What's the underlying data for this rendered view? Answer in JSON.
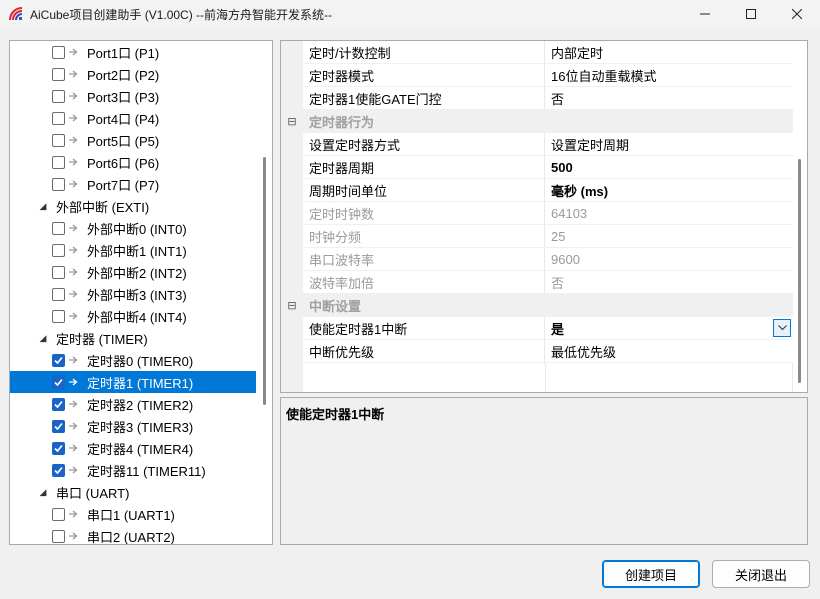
{
  "window": {
    "title": "AiCube项目创建助手 (V1.00C) --前海方舟智能开发系统--",
    "minimize_icon": "minimize-icon",
    "maximize_icon": "maximize-icon",
    "close_icon": "close-icon"
  },
  "tree": {
    "items": [
      {
        "type": "leaf",
        "label": "Port1口 (P1)",
        "checked": false
      },
      {
        "type": "leaf",
        "label": "Port2口 (P2)",
        "checked": false
      },
      {
        "type": "leaf",
        "label": "Port3口 (P3)",
        "checked": false
      },
      {
        "type": "leaf",
        "label": "Port4口 (P4)",
        "checked": false
      },
      {
        "type": "leaf",
        "label": "Port5口 (P5)",
        "checked": false
      },
      {
        "type": "leaf",
        "label": "Port6口 (P6)",
        "checked": false
      },
      {
        "type": "leaf",
        "label": "Port7口 (P7)",
        "checked": false
      },
      {
        "type": "group",
        "label": "外部中断 (EXTI)"
      },
      {
        "type": "leaf",
        "label": "外部中断0 (INT0)",
        "checked": false
      },
      {
        "type": "leaf",
        "label": "外部中断1 (INT1)",
        "checked": false
      },
      {
        "type": "leaf",
        "label": "外部中断2 (INT2)",
        "checked": false
      },
      {
        "type": "leaf",
        "label": "外部中断3 (INT3)",
        "checked": false
      },
      {
        "type": "leaf",
        "label": "外部中断4 (INT4)",
        "checked": false
      },
      {
        "type": "group",
        "label": "定时器 (TIMER)"
      },
      {
        "type": "leaf",
        "label": "定时器0 (TIMER0)",
        "checked": true
      },
      {
        "type": "leaf",
        "label": "定时器1 (TIMER1)",
        "checked": true,
        "selected": true
      },
      {
        "type": "leaf",
        "label": "定时器2 (TIMER2)",
        "checked": true
      },
      {
        "type": "leaf",
        "label": "定时器3 (TIMER3)",
        "checked": true
      },
      {
        "type": "leaf",
        "label": "定时器4 (TIMER4)",
        "checked": true
      },
      {
        "type": "leaf",
        "label": "定时器11 (TIMER11)",
        "checked": true
      },
      {
        "type": "group",
        "label": "串口 (UART)"
      },
      {
        "type": "leaf",
        "label": "串口1 (UART1)",
        "checked": false
      },
      {
        "type": "leaf",
        "label": "串口2 (UART2)",
        "checked": false
      }
    ]
  },
  "properties": {
    "rows": [
      {
        "kind": "prop",
        "name": "定时/计数控制",
        "value": "内部定时"
      },
      {
        "kind": "prop",
        "name": "定时器模式",
        "value": "16位自动重载模式"
      },
      {
        "kind": "prop",
        "name": "定时器1使能GATE门控",
        "value": "否"
      },
      {
        "kind": "category",
        "name": "定时器行为"
      },
      {
        "kind": "prop",
        "name": "设置定时器方式",
        "value": "设置定时周期"
      },
      {
        "kind": "prop",
        "name": "定时器周期",
        "value": "500",
        "bold": true
      },
      {
        "kind": "prop",
        "name": "周期时间单位",
        "value": "毫秒 (ms)",
        "bold": true
      },
      {
        "kind": "prop",
        "name": "定时时钟数",
        "value": "64103",
        "disabled": true
      },
      {
        "kind": "prop",
        "name": "时钟分频",
        "value": "25",
        "disabled": true
      },
      {
        "kind": "prop",
        "name": "串口波特率",
        "value": "9600",
        "disabled": true
      },
      {
        "kind": "prop",
        "name": "波特率加倍",
        "value": "否",
        "disabled": true
      },
      {
        "kind": "category",
        "name": "中断设置"
      },
      {
        "kind": "prop",
        "name": "使能定时器1中断",
        "value": "是",
        "bold": true,
        "dropdown": true
      },
      {
        "kind": "prop",
        "name": "中断优先级",
        "value": "最低优先级"
      }
    ]
  },
  "description": {
    "title": "使能定时器1中断"
  },
  "buttons": {
    "create": "创建项目",
    "exit": "关闭退出"
  },
  "colors": {
    "selection": "#0078d7",
    "checkbox_checked": "#1a64c8"
  }
}
